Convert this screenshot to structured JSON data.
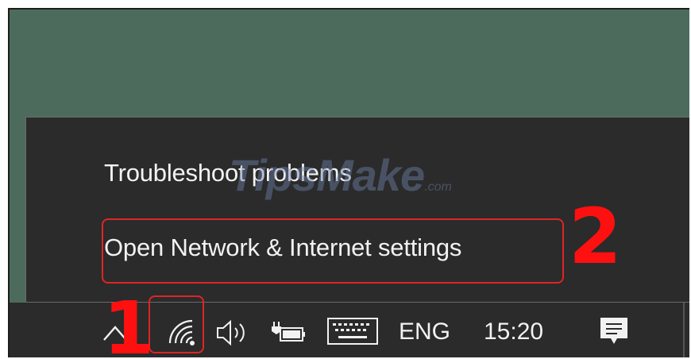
{
  "context_menu": {
    "items": [
      {
        "label": "Troubleshoot problems"
      },
      {
        "label": "Open Network & Internet settings"
      }
    ]
  },
  "watermark": {
    "text": "TipsMake",
    "suffix": ".com"
  },
  "annotations": {
    "step_one": "1",
    "step_two": "2",
    "highlight_color": "#e02424"
  },
  "taskbar": {
    "icons": [
      "chevron-up-icon",
      "wifi-icon",
      "volume-icon",
      "battery-icon",
      "touch-keyboard-icon",
      "action-center-icon"
    ],
    "language": "ENG",
    "time": "15:20"
  },
  "colors": {
    "desktop": "#4d6b5c",
    "menu_bg": "#2b2b2b",
    "text": "#f2f2f2",
    "annotation": "#ff1010"
  }
}
